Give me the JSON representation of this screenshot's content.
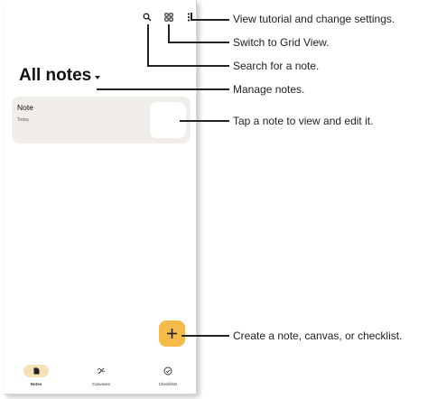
{
  "header": {
    "title": "All notes",
    "icons": [
      "search-icon",
      "grid-view-icon",
      "more-vert-icon"
    ]
  },
  "notes": [
    {
      "title": "Note",
      "date": "Today"
    }
  ],
  "fab": {
    "icon": "plus-icon"
  },
  "bottom_nav": [
    {
      "label": "Notes",
      "icon": "notes-icon",
      "active": true
    },
    {
      "label": "Canvases",
      "icon": "canvas-icon",
      "active": false
    },
    {
      "label": "Checklists",
      "icon": "checklist-icon",
      "active": false
    }
  ],
  "callouts": {
    "settings": "View tutorial and change settings.",
    "grid": "Switch to Grid View.",
    "search": "Search for a note.",
    "manage": "Manage notes.",
    "tap_note": "Tap a note to view and edit it.",
    "create": "Create a note, canvas, or checklist."
  },
  "colors": {
    "accent": "#f4bb4b",
    "active_nav": "#f4e1b6",
    "card": "#f1eee9"
  }
}
